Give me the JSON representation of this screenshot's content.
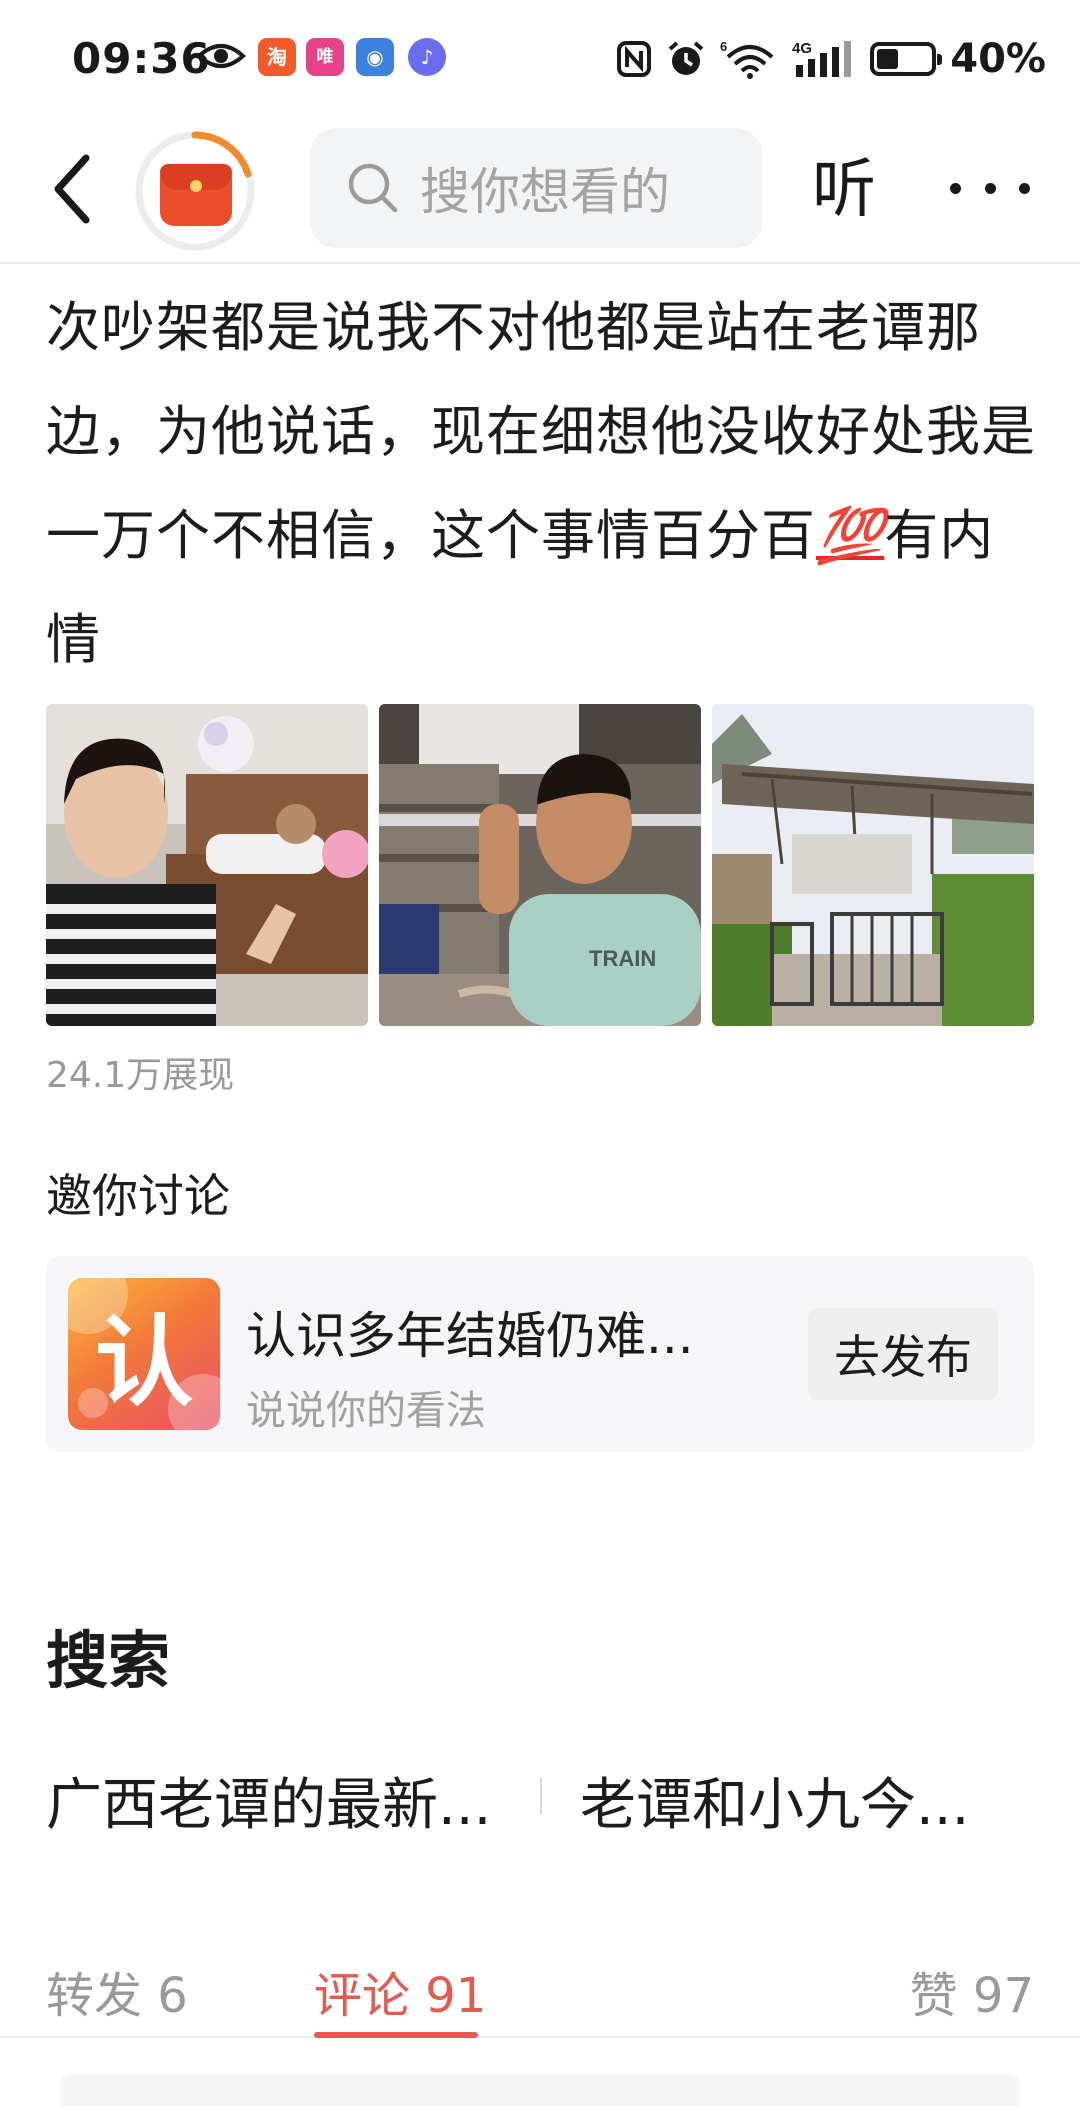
{
  "status_bar": {
    "time": "09:36",
    "battery_pct": "40%",
    "battery_level": 0.4,
    "network": "4G",
    "wifi": "6",
    "app_icons": [
      {
        "name": "taobao-icon",
        "glyph": "淘",
        "color": "#f35a2a"
      },
      {
        "name": "vipshop-icon",
        "glyph": "唯",
        "color": "#e8418a"
      },
      {
        "name": "security-icon",
        "glyph": "◉",
        "color": "#3c80e0"
      },
      {
        "name": "music-icon",
        "glyph": "♪",
        "color": "#6a6df0"
      }
    ]
  },
  "header": {
    "search_placeholder": "搜你想看的",
    "listen_label": "听"
  },
  "post": {
    "text_before_emoji": "次吵架都是说我不对他都是站在老谭那边，为他说话，现在细想他没收好处我是一万个不相信，这个事情百分百",
    "emoji": "💯",
    "text_after_emoji": "有内情",
    "views": "24.1万展现"
  },
  "discussion": {
    "title": "邀你讨论",
    "topic_glyph": "认",
    "topic_title": "认识多年结婚仍难...",
    "topic_sub": "说说你的看法",
    "publish_label": "去发布"
  },
  "search_section": {
    "title": "搜索",
    "suggestions": [
      "广西老谭的最新...",
      "老谭和小九今..."
    ]
  },
  "tabs": [
    {
      "label": "转发 6",
      "active": false
    },
    {
      "label": "评论 91",
      "active": true
    },
    {
      "label": "赞 97",
      "active": false
    }
  ],
  "colors": {
    "accent": "#e35a52",
    "avatar_ring": "#f08b2e"
  }
}
